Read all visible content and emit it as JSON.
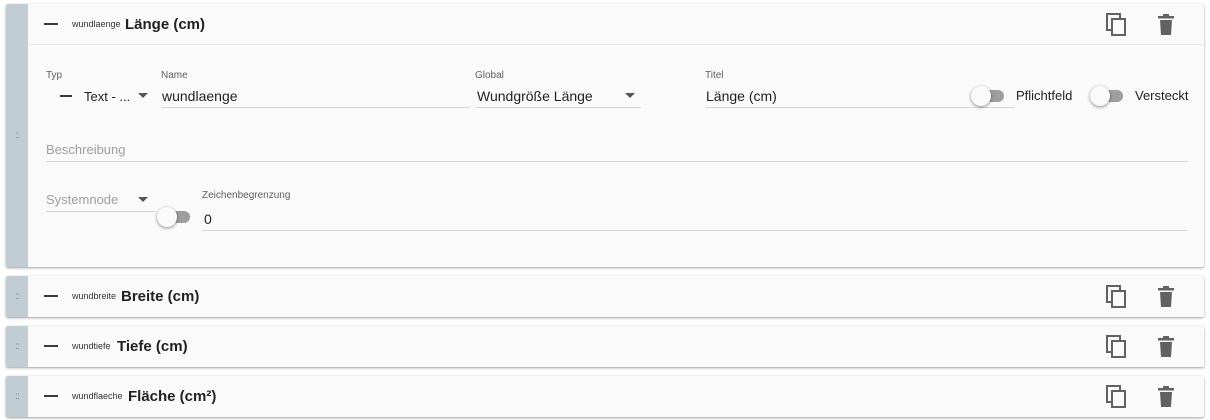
{
  "handle_glyph": "::",
  "fields_list": [
    {
      "key": "wundlaenge",
      "title": "Länge (cm)",
      "expanded": true,
      "form": {
        "type_label": "Typ",
        "type_value": "Text - ...",
        "name_label": "Name",
        "name_value": "wundlaenge",
        "global_label": "Global",
        "global_value": "Wundgröße Länge",
        "titel_label": "Titel",
        "titel_value": "Länge (cm)",
        "pflichtfeld_label": "Pflichtfeld",
        "versteckt_label": "Versteckt",
        "beschreibung_placeholder": "Beschreibung",
        "systemnode_placeholder": "Systemnode",
        "zeichen_label": "Zeichenbegrenzung",
        "zeichen_value": "0"
      }
    },
    {
      "key": "wundbreite",
      "title": "Breite (cm)",
      "expanded": false
    },
    {
      "key": "wundtiefe",
      "title": "Tiefe (cm)",
      "expanded": false
    },
    {
      "key": "wundflaeche",
      "title": "Fläche (cm²)",
      "expanded": false
    }
  ],
  "icons": {
    "copy": "copy-icon",
    "delete": "trash-icon",
    "collapse": "minus-icon",
    "drag": "drag-handle-icon"
  },
  "colors": {
    "handle": "#c2ccd3",
    "card": "#fafafa",
    "icon": "#616161"
  }
}
